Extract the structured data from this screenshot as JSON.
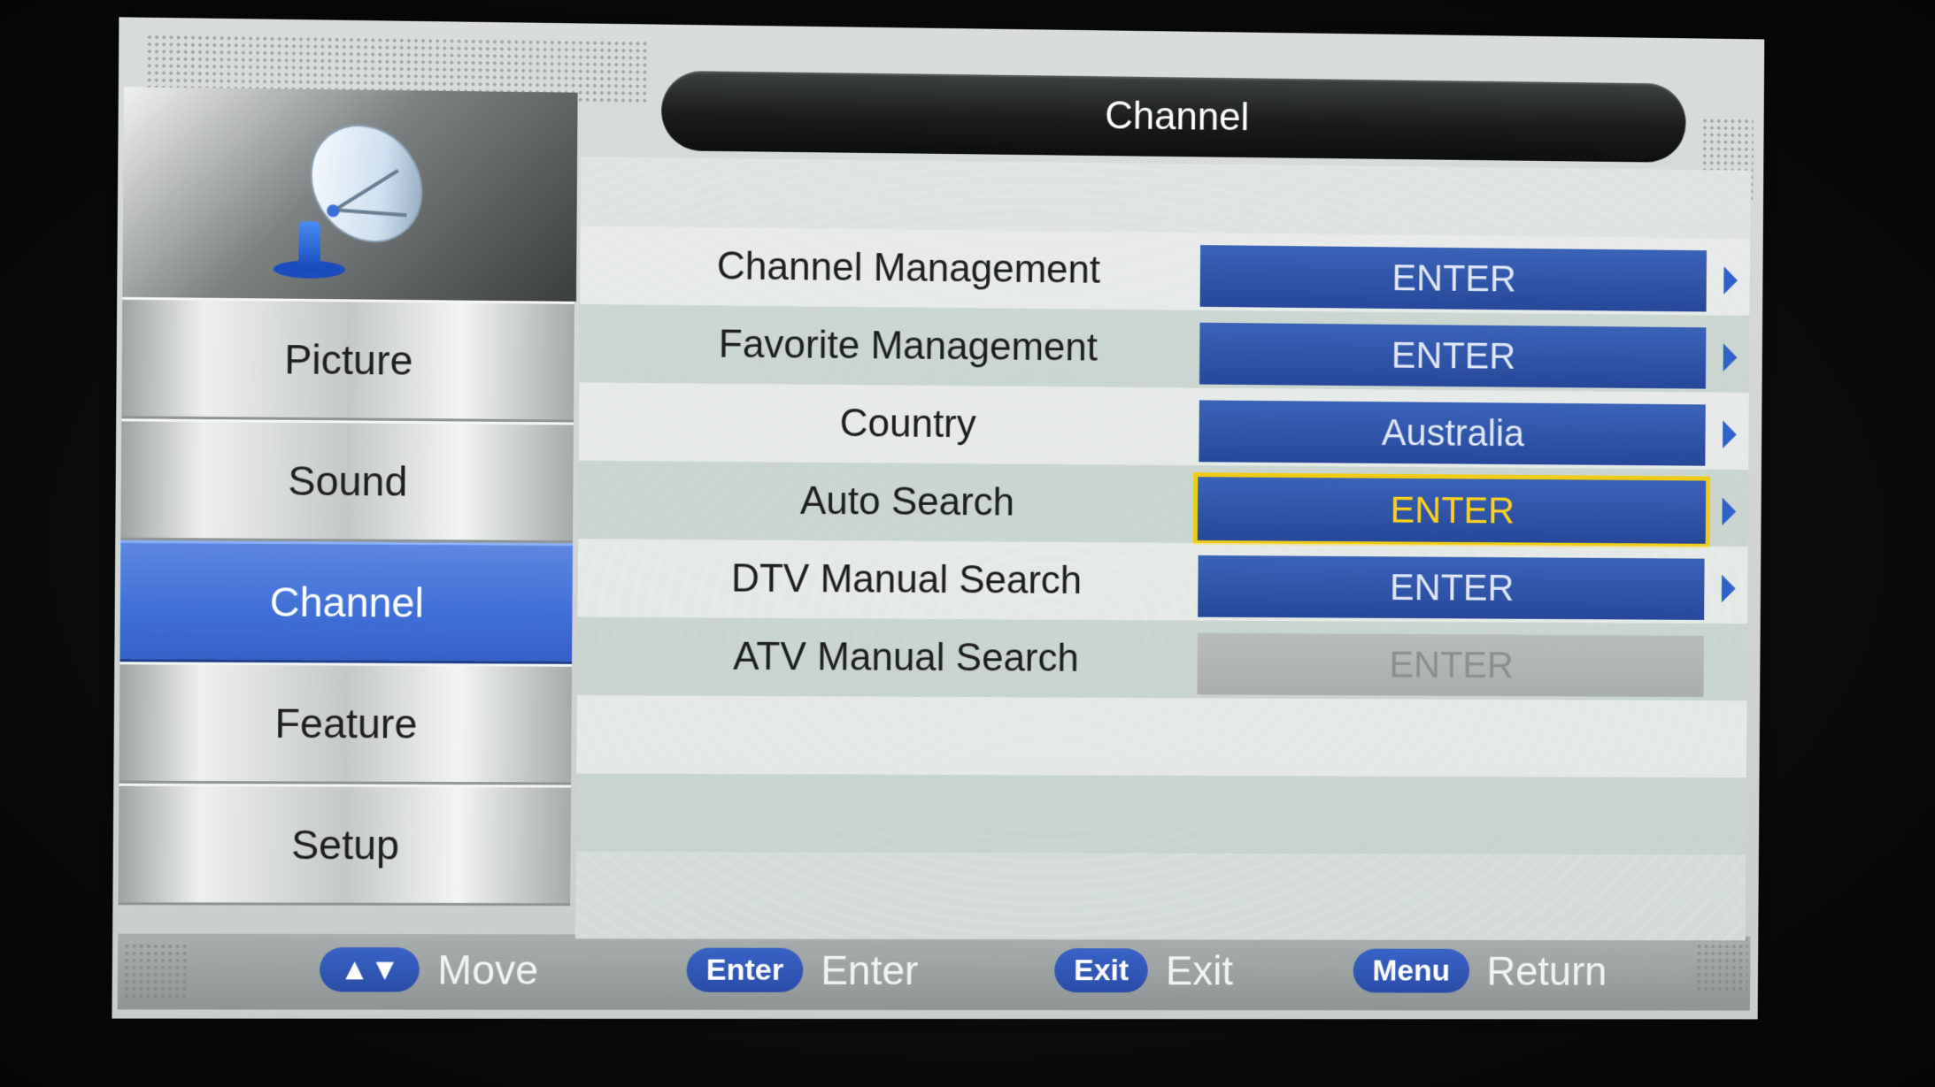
{
  "title": "Channel",
  "sidebar": {
    "icon": "satellite-dish-icon",
    "items": [
      {
        "label": "Picture",
        "active": false
      },
      {
        "label": "Sound",
        "active": false
      },
      {
        "label": "Channel",
        "active": true
      },
      {
        "label": "Feature",
        "active": false
      },
      {
        "label": "Setup",
        "active": false
      }
    ]
  },
  "menu": {
    "rows": [
      {
        "label": "Channel Management",
        "value": "ENTER",
        "state": "normal"
      },
      {
        "label": "Favorite Management",
        "value": "ENTER",
        "state": "normal"
      },
      {
        "label": "Country",
        "value": "Australia",
        "state": "normal"
      },
      {
        "label": "Auto Search",
        "value": "ENTER",
        "state": "selected"
      },
      {
        "label": "DTV Manual Search",
        "value": "ENTER",
        "state": "normal"
      },
      {
        "label": "ATV Manual Search",
        "value": "ENTER",
        "state": "disabled"
      }
    ]
  },
  "footer": {
    "move": {
      "key": "▲▼",
      "label": "Move"
    },
    "enter": {
      "key": "Enter",
      "label": "Enter"
    },
    "exit": {
      "key": "Exit",
      "label": "Exit"
    },
    "menu": {
      "key": "Menu",
      "label": "Return"
    }
  },
  "colors": {
    "accent_blue": "#3f6fd6",
    "value_blue": "#27489a",
    "selection_yellow": "#f0cc14",
    "disabled_gray": "#a9adad"
  }
}
